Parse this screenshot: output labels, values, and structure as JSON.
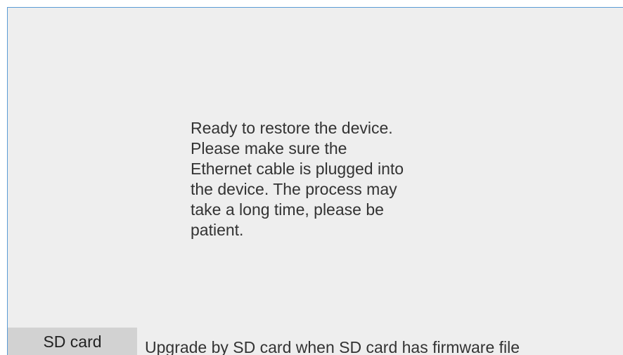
{
  "dialog": {
    "message": "Ready to restore the device.\nPlease make sure the\nEthernet cable is plugged into\nthe device. The process may\ntake a long time, please be\npatient."
  },
  "sd_card": {
    "button_label": "SD card",
    "description": "Upgrade by SD card when SD card has firmware file"
  },
  "colors": {
    "background": "#eeeeee",
    "border_accent": "#5b9bd5",
    "button_bg": "#d2d2d2",
    "text": "#333333"
  }
}
